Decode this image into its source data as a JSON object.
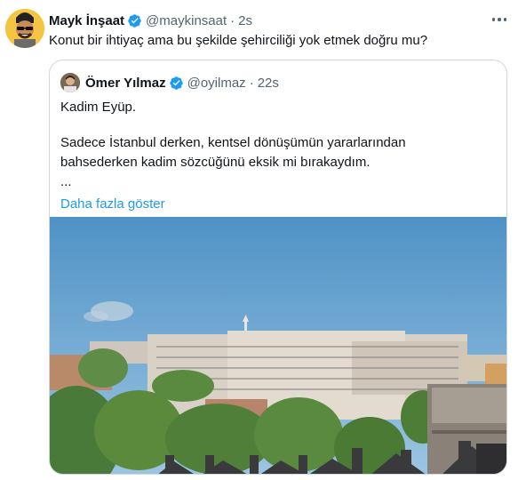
{
  "tweet": {
    "author": {
      "name": "Mayk İnşaat",
      "handle": "@maykinsaat",
      "time": "2s",
      "verified": true
    },
    "text": "Konut bir ihtiyaç ama bu şekilde şehirciliği yok etmek doğru mu?",
    "more_icon": "more-horizontal-icon"
  },
  "quote": {
    "author": {
      "name": "Ömer Yılmaz",
      "handle": "@oyilmaz",
      "time": "22s",
      "verified": true
    },
    "lines": [
      "Kadim Eyüp.",
      "Sadece İstanbul derken, kentsel dönüşümün yararlarından",
      "bahsederken kadim sözcüğünü eksik mi bırakaydım.",
      "..."
    ],
    "show_more": "Daha fazla göster"
  },
  "separator": "·",
  "colors": {
    "text": "#0f1419",
    "secondary": "#536471",
    "link": "#1d9bf0",
    "border": "#cfd9de",
    "verified": "#1d9bf0"
  }
}
